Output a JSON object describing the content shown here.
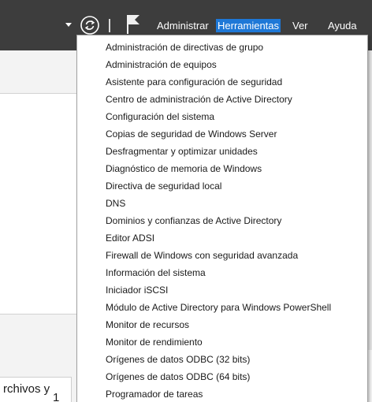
{
  "menubar": {
    "items": [
      {
        "label": "Administrar"
      },
      {
        "label": "Herramientas"
      },
      {
        "label": "Ver"
      },
      {
        "label": "Ayuda"
      }
    ],
    "active_item": "Herramientas",
    "accent_color": "#1e78d7",
    "bar_color": "#3d3d3d"
  },
  "toolbar_icons": [
    "chevron-down-icon",
    "refresh-icon",
    "flag-icon"
  ],
  "tools_menu": {
    "items": [
      {
        "label": "Administración de directivas de grupo"
      },
      {
        "label": "Administración de equipos"
      },
      {
        "label": "Asistente para configuración de seguridad"
      },
      {
        "label": "Centro de administración de Active Directory"
      },
      {
        "label": "Configuración del sistema"
      },
      {
        "label": "Copias de seguridad de Windows Server"
      },
      {
        "label": "Desfragmentar y optimizar unidades"
      },
      {
        "label": "Diagnóstico de memoria de Windows"
      },
      {
        "label": "Directiva de seguridad local"
      },
      {
        "label": "DNS"
      },
      {
        "label": "Dominios y confianzas de Active Directory"
      },
      {
        "label": "Editor ADSI"
      },
      {
        "label": "Firewall de Windows con seguridad avanzada"
      },
      {
        "label": "Información del sistema"
      },
      {
        "label": "Iniciador iSCSI"
      },
      {
        "label": "Módulo de Active Directory para Windows PowerShell"
      },
      {
        "label": "Monitor de recursos"
      },
      {
        "label": "Monitor de rendimiento"
      },
      {
        "label": "Orígenes de datos ODBC (32 bits)"
      },
      {
        "label": "Orígenes de datos ODBC (64 bits)"
      },
      {
        "label": "Programador de tareas"
      }
    ]
  },
  "background_card": {
    "text": "rchivos y",
    "count": "1"
  }
}
